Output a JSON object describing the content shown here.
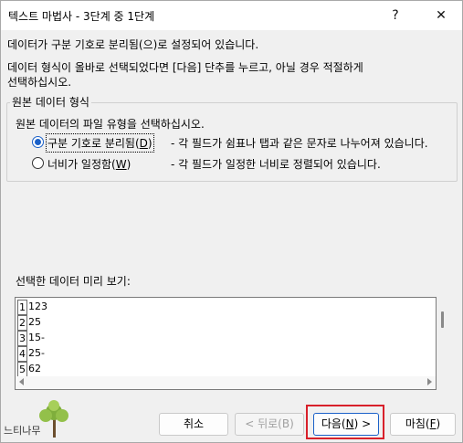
{
  "window": {
    "title": "텍스트 마법사 - 3단계 중 1단계",
    "help_label": "?",
    "close_label": "✕"
  },
  "intro": {
    "line1": "데이터가 구분 기호로 분리됨(으)로 설정되어 있습니다.",
    "line2": "데이터 형식이 올바로 선택되었다면 [다음] 단추를 누르고, 아닐 경우 적절하게",
    "line3": "선택하십시오."
  },
  "group": {
    "label": "원본 데이터 형식",
    "instruction": "원본 데이터의 파일 유형을 선택하십시오.",
    "options": [
      {
        "label": "구분 기호로 분리됨(D)",
        "label_main": "구분 기호로 분리됨(",
        "label_key": "D",
        "label_end": ")",
        "description": "- 각 필드가 쉼표나 탭과 같은 문자로 나누어져 있습니다.",
        "selected": true
      },
      {
        "label": "너비가 일정함(W)",
        "label_main": "너비가 일정함(",
        "label_key": "W",
        "label_end": ")",
        "description": "- 각 필드가 일정한 너비로 정렬되어 있습니다.",
        "selected": false
      }
    ]
  },
  "preview": {
    "label": "선택한 데이터 미리 보기:",
    "rows": [
      {
        "num": "1",
        "value": "123"
      },
      {
        "num": "2",
        "value": "25"
      },
      {
        "num": "3",
        "value": "15-"
      },
      {
        "num": "4",
        "value": "25-"
      },
      {
        "num": "5",
        "value": "62"
      }
    ]
  },
  "buttons": {
    "cancel": "취소",
    "back": "< 뒤로(B)",
    "next_main": "다음(",
    "next_key": "N",
    "next_end": ") >",
    "finish_main": "마침(",
    "finish_key": "F",
    "finish_end": ")"
  },
  "watermark": {
    "text": "느티나무"
  },
  "colors": {
    "accent": "#1a60c8",
    "highlight": "#d8202a"
  }
}
